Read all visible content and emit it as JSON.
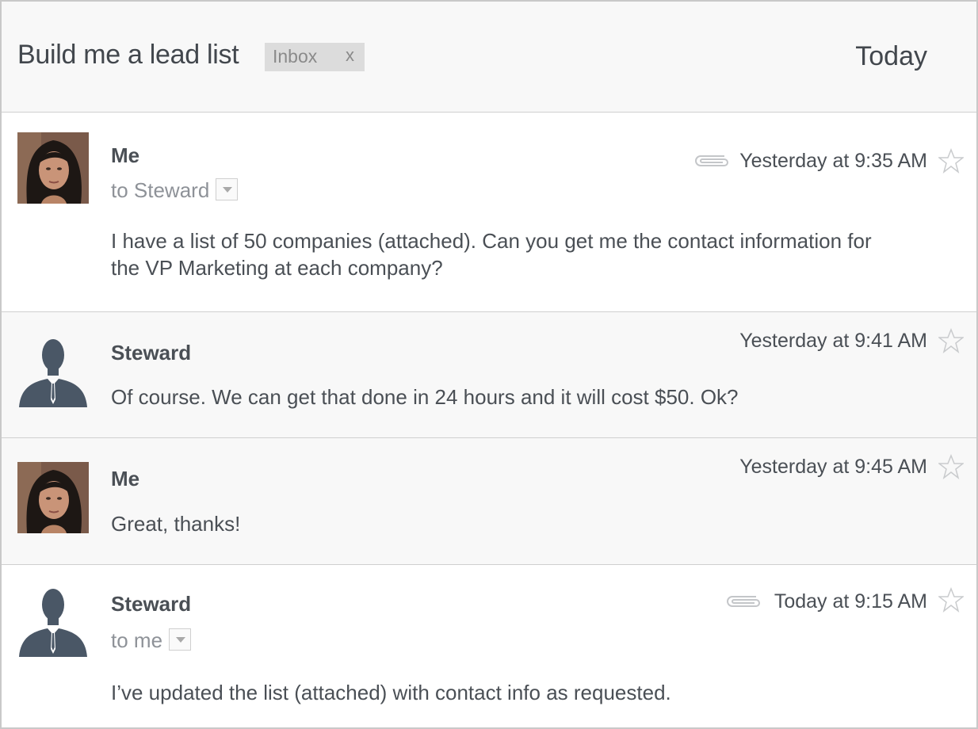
{
  "thread": {
    "subject": "Build me a lead list",
    "label": "Inbox",
    "label_close": "x",
    "date": "Today"
  },
  "messages": [
    {
      "sender": "Me",
      "recipient": "to Steward",
      "timestamp": "Yesterday at 9:35 AM",
      "has_attachment": true,
      "body": "I have a list of 50 companies (attached). Can you get me the contact information for the VP Marketing at each company?",
      "avatar": "user-photo"
    },
    {
      "sender": "Steward",
      "timestamp": "Yesterday at 9:41 AM",
      "has_attachment": false,
      "body": "Of course. We can get that done in 24 hours and it will cost $50. Ok?",
      "avatar": "person-silhouette-icon"
    },
    {
      "sender": "Me",
      "timestamp": "Yesterday at 9:45 AM",
      "has_attachment": false,
      "body": "Great, thanks!",
      "avatar": "user-photo"
    },
    {
      "sender": "Steward",
      "recipient": "to me",
      "timestamp": "Today at 9:15 AM",
      "has_attachment": true,
      "body": "I’ve updated the list (attached) with contact info as requested.",
      "avatar": "person-silhouette-icon"
    }
  ],
  "icons": {
    "attachment": "paperclip-icon",
    "star": "star-outline-icon",
    "dropdown": "chevron-down-icon"
  },
  "colors": {
    "header_bg": "#f8f8f8",
    "text": "#4a4f55",
    "muted": "#8e9298",
    "silhouette": "#4a5766"
  }
}
